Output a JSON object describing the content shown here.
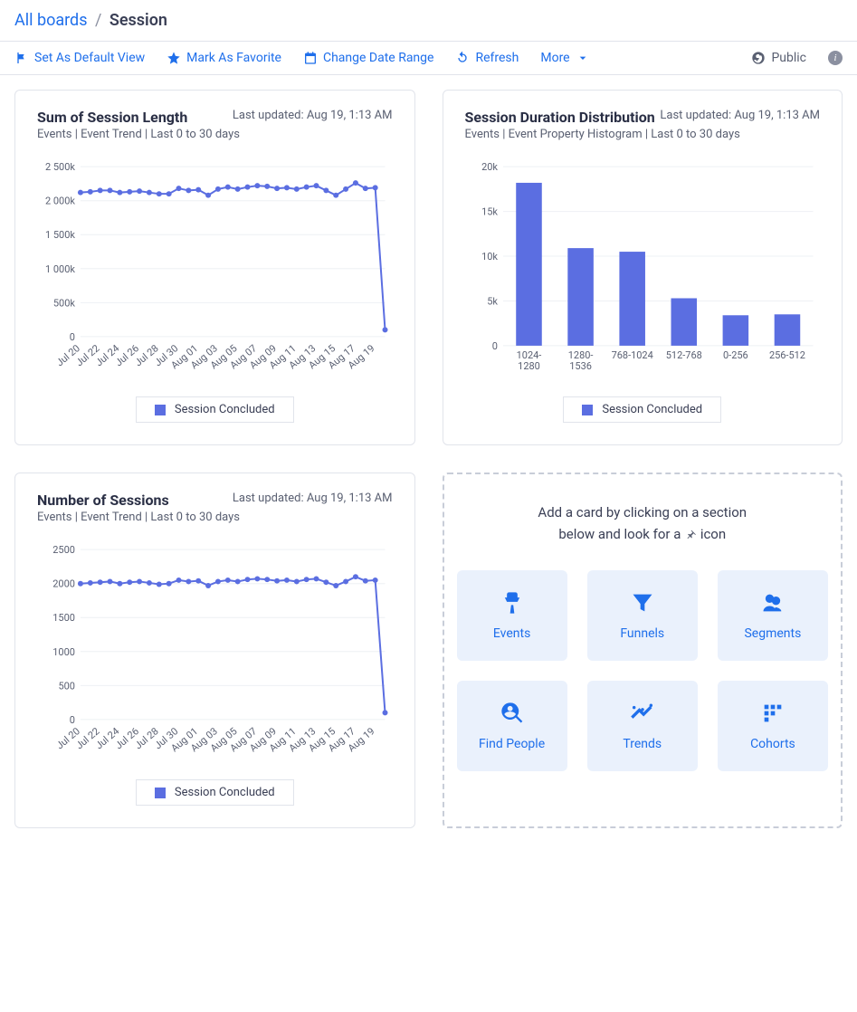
{
  "breadcrumb": {
    "all": "All boards",
    "current": "Session"
  },
  "toolbar": {
    "default": "Set As Default View",
    "favorite": "Mark As Favorite",
    "daterange": "Change Date Range",
    "refresh": "Refresh",
    "more": "More",
    "public": "Public"
  },
  "cards": {
    "sum": {
      "title": "Sum of Session Length",
      "updated": "Last updated: Aug 19, 1:13 AM",
      "sub": "Events | Event Trend | Last 0 to 30 days",
      "legend": "Session Concluded"
    },
    "dist": {
      "title": "Session Duration Distribution",
      "updated": "Last updated: Aug 19, 1:13 AM",
      "sub": "Events | Event Property Histogram | Last 0 to 30 days",
      "legend": "Session Concluded"
    },
    "num": {
      "title": "Number of Sessions",
      "updated": "Last updated: Aug 19, 1:13 AM",
      "sub": "Events | Event Trend | Last 0 to 30 days",
      "legend": "Session Concluded"
    }
  },
  "placeholder": {
    "line1": "Add a card by clicking on a section",
    "line2_a": "below and look for a ",
    "line2_b": " icon",
    "items": {
      "events": "Events",
      "funnels": "Funnels",
      "segments": "Segments",
      "find": "Find People",
      "trends": "Trends",
      "cohorts": "Cohorts"
    }
  },
  "chart_data": [
    {
      "id": "sum_session_length",
      "type": "line",
      "title": "Sum of Session Length",
      "xlabel": "",
      "ylabel": "",
      "ylim": [
        0,
        2500000
      ],
      "yticks": [
        "0",
        "500k",
        "1 000k",
        "1 500k",
        "2 000k",
        "2 500k"
      ],
      "categories": [
        "Jul 20",
        "Jul 22",
        "Jul 24",
        "Jul 26",
        "Jul 28",
        "Jul 30",
        "Aug 01",
        "Aug 03",
        "Aug 05",
        "Aug 07",
        "Aug 09",
        "Aug 11",
        "Aug 13",
        "Aug 15",
        "Aug 17",
        "Aug 19"
      ],
      "series": [
        {
          "name": "Session Concluded",
          "values": [
            2120000,
            2130000,
            2150000,
            2150000,
            2120000,
            2130000,
            2140000,
            2120000,
            2100000,
            2100000,
            2180000,
            2150000,
            2160000,
            2080000,
            2170000,
            2200000,
            2170000,
            2200000,
            2220000,
            2210000,
            2180000,
            2190000,
            2170000,
            2200000,
            2220000,
            2150000,
            2080000,
            2170000,
            2260000,
            2180000,
            2190000,
            100000
          ]
        }
      ]
    },
    {
      "id": "session_duration_dist",
      "type": "bar",
      "title": "Session Duration Distribution",
      "xlabel": "",
      "ylabel": "",
      "ylim": [
        0,
        20000
      ],
      "yticks": [
        "0",
        "5k",
        "10k",
        "15k",
        "20k"
      ],
      "categories": [
        "1024-1280",
        "1280-1536",
        "768-1024",
        "512-768",
        "0-256",
        "256-512"
      ],
      "series": [
        {
          "name": "Session Concluded",
          "values": [
            18200,
            10900,
            10500,
            5300,
            3400,
            3500
          ]
        }
      ]
    },
    {
      "id": "number_of_sessions",
      "type": "line",
      "title": "Number of Sessions",
      "xlabel": "",
      "ylabel": "",
      "ylim": [
        0,
        2500
      ],
      "yticks": [
        "0",
        "500",
        "1000",
        "1500",
        "2000",
        "2500"
      ],
      "categories": [
        "Jul 20",
        "Jul 22",
        "Jul 24",
        "Jul 26",
        "Jul 28",
        "Jul 30",
        "Aug 01",
        "Aug 03",
        "Aug 05",
        "Aug 07",
        "Aug 09",
        "Aug 11",
        "Aug 13",
        "Aug 15",
        "Aug 17",
        "Aug 19"
      ],
      "series": [
        {
          "name": "Session Concluded",
          "values": [
            2000,
            2010,
            2020,
            2030,
            2000,
            2020,
            2030,
            2010,
            1990,
            2000,
            2050,
            2030,
            2040,
            1970,
            2030,
            2050,
            2030,
            2060,
            2070,
            2060,
            2040,
            2050,
            2030,
            2060,
            2070,
            2020,
            1970,
            2030,
            2100,
            2040,
            2050,
            100
          ]
        }
      ]
    }
  ]
}
